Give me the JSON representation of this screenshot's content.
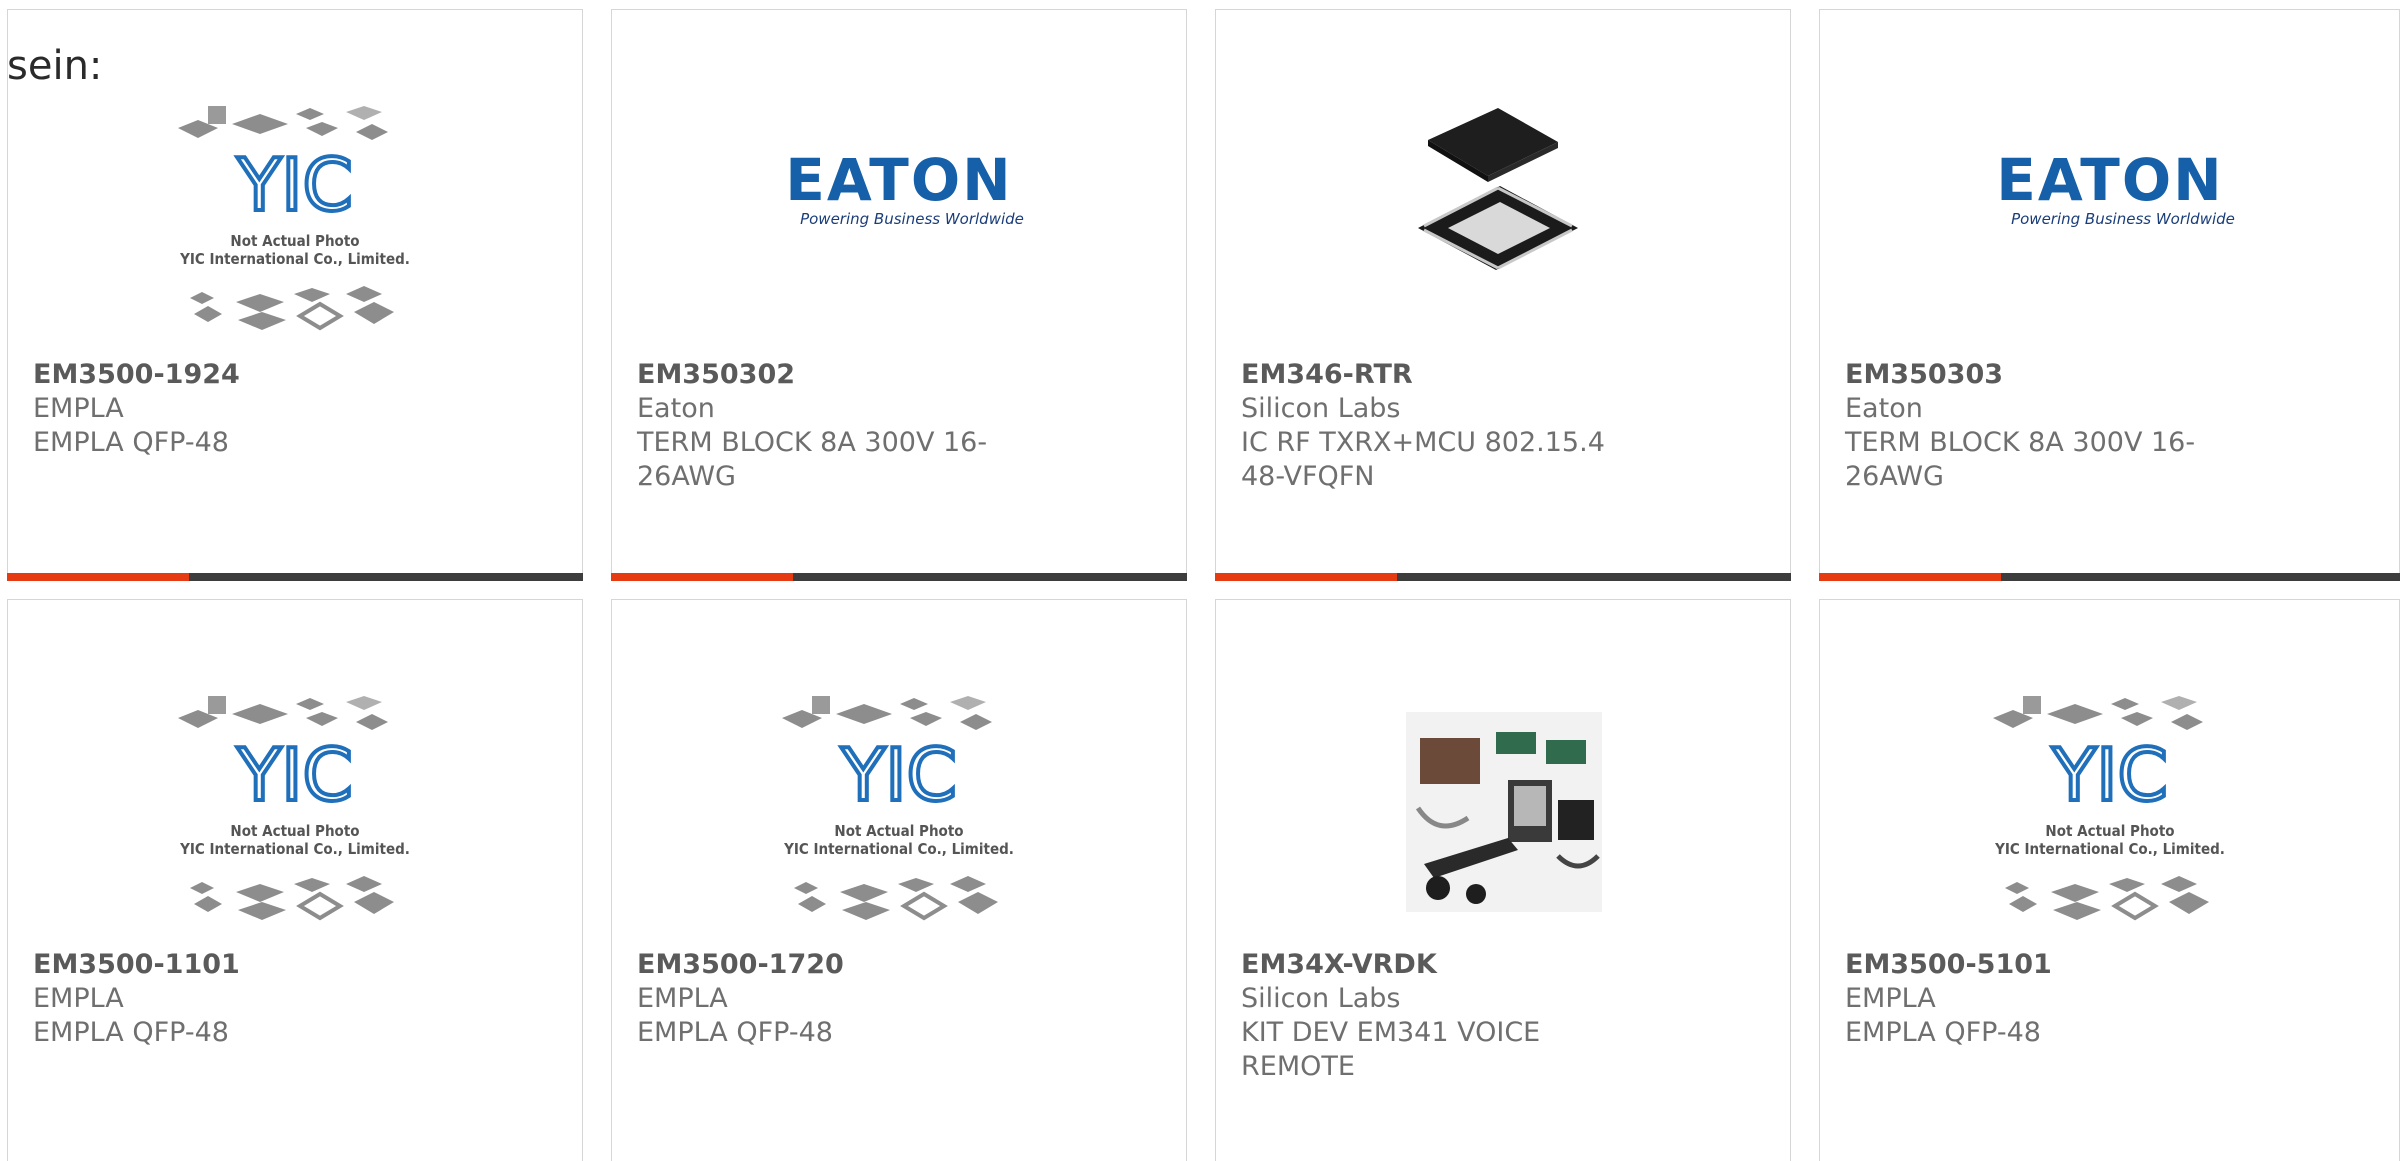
{
  "intro": {
    "text": "sein:"
  },
  "placeholder_image": {
    "logo_text": "YIC",
    "caption_line1": "Not Actual Photo",
    "caption_line2": "YIC International Co., Limited."
  },
  "eaton_logo": {
    "wordmark": "EATON",
    "tagline": "Powering Business Worldwide"
  },
  "colors": {
    "accent": "#e63a12",
    "bar": "#3d3d3d",
    "yic_blue": "#1f6fba",
    "eaton_blue": "#1560a8"
  },
  "products": [
    {
      "part_number": "EM3500-1924",
      "manufacturer": "EMPLA",
      "description": "EMPLA QFP-48",
      "image": "yic-placeholder"
    },
    {
      "part_number": "EM350302",
      "manufacturer": "Eaton",
      "description": "TERM BLOCK 8A 300V 16-26AWG",
      "image": "eaton-logo"
    },
    {
      "part_number": "EM346-RTR",
      "manufacturer": "Silicon Labs",
      "description": "IC RF TXRX+MCU 802.15.4 48-VFQFN",
      "image": "qfn-chip-photo"
    },
    {
      "part_number": "EM350303",
      "manufacturer": "Eaton",
      "description": "TERM BLOCK 8A 300V 16-26AWG",
      "image": "eaton-logo"
    },
    {
      "part_number": "EM3500-1101",
      "manufacturer": "EMPLA",
      "description": "EMPLA QFP-48",
      "image": "yic-placeholder"
    },
    {
      "part_number": "EM3500-1720",
      "manufacturer": "EMPLA",
      "description": "EMPLA QFP-48",
      "image": "yic-placeholder"
    },
    {
      "part_number": "EM34X-VRDK",
      "manufacturer": "Silicon Labs",
      "description": "KIT DEV EM341 VOICE REMOTE",
      "image": "dev-kit-photo"
    },
    {
      "part_number": "EM3500-5101",
      "manufacturer": "EMPLA",
      "description": "EMPLA QFP-48",
      "image": "yic-placeholder"
    }
  ]
}
